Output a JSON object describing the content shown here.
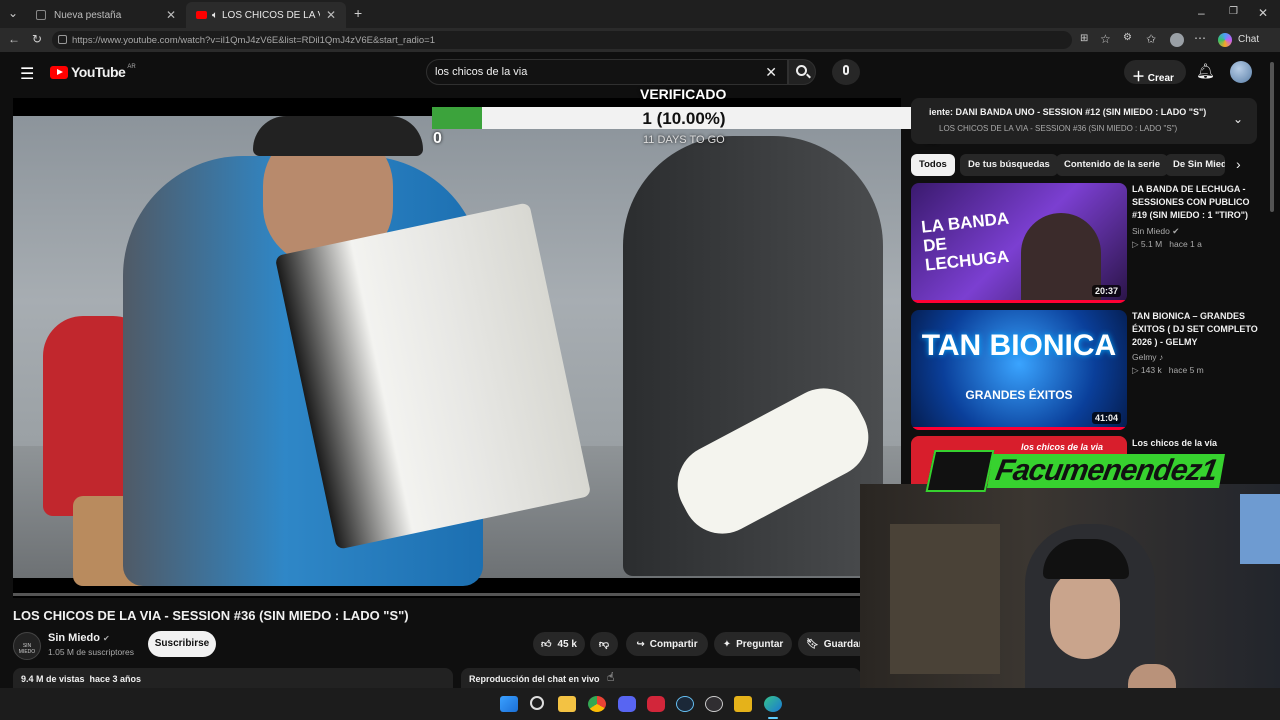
{
  "browser": {
    "tabs": [
      {
        "label": "Nueva pestaña"
      },
      {
        "label": "LOS CHICOS DE LA VIA - SESSI"
      }
    ],
    "url": "https://www.youtube.com/watch?v=il1QmJ4zV6E&list=RDil1QmJ4zV6E&start_radio=1",
    "chat_label": "Chat"
  },
  "youtube": {
    "logo": "YouTube",
    "region": "AR",
    "search_value": "los chicos de la via",
    "create_label": "Crear"
  },
  "overlay": {
    "verified": "VERIFICADO",
    "progress_text": "1 (10.00%)",
    "progress_fraction": 0.1,
    "min": "0",
    "max": "10",
    "days": "11 DAYS TO GO"
  },
  "video": {
    "title": "LOS CHICOS DE LA VIA - SESSION #36 (SIN MIEDO : LADO \"S\")",
    "channel": "Sin Miedo",
    "subscribers": "1.05 M de suscriptores",
    "subscribe_label": "Suscribirse",
    "likes": "45 k",
    "share_label": "Compartir",
    "ask_label": "Preguntar",
    "save_label": "Guardar",
    "views_line": "9.4 M de vistas  hace 3 años",
    "chat_replay": "Reproducción del chat en vivo"
  },
  "playlist": {
    "next_label": "iente: DANI BANDA UNO - SESSION #12 (SIN MIEDO : LADO \"S\")",
    "sub_label": "LOS CHICOS DE LA VIA - SESSION #36 (SIN MIEDO : LADO \"S\")"
  },
  "filters": [
    "Todos",
    "De tus búsquedas",
    "Contenido de la serie",
    "De Sin Mied"
  ],
  "recommendations": [
    {
      "title": "LA BANDA DE LECHUGA - SESSIONES CON PUBLICO #19 (SIN MIEDO : 1 \"TIRO\")",
      "channel": "Sin Miedo",
      "meta": "5.1 M   hace 1 a",
      "duration": "20:37",
      "thumb_text": "LA BANDA DE LECHUGA"
    },
    {
      "title": "TAN BIONICA – GRANDES ÉXITOS ( DJ SET COMPLETO 2026 ) - GELMY",
      "channel": "Gelmy",
      "meta": "143 k   hace 5 m",
      "duration": "41:04",
      "thumb_text": "TAN BIONICA",
      "thumb_sub": "GRANDES ÉXITOS"
    },
    {
      "title": "Los chicos de la vía",
      "channel": "",
      "meta": "",
      "duration": "",
      "thumb_text": "los chicos de la via"
    }
  ],
  "stream_overlay": "Facumenendez1",
  "colors": {
    "progress_green": "#3ca33c",
    "yt_red": "#ff0000"
  }
}
